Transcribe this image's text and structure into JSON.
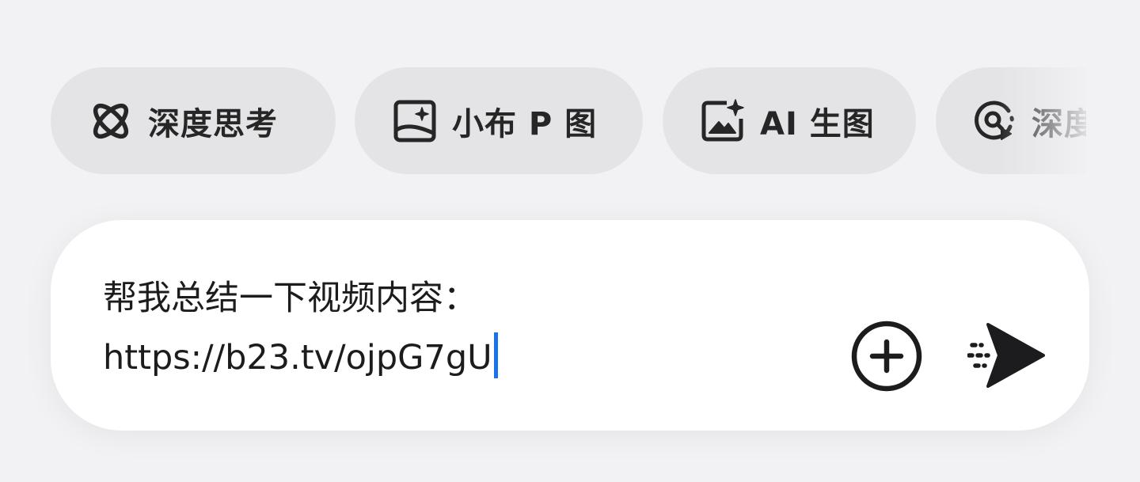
{
  "chips": [
    {
      "label": "深度思考",
      "icon": "atom-icon"
    },
    {
      "label": "小布 P 图",
      "icon": "image-edit-icon"
    },
    {
      "label": "AI 生图",
      "icon": "image-sparkle-icon"
    },
    {
      "label": "深度",
      "icon": "video-search-icon"
    }
  ],
  "input": {
    "line1": "帮我总结一下视频内容：",
    "line2": "https://b23.tv/ojpG7gU"
  },
  "buttons": {
    "add_icon": "plus-circle-icon",
    "send_icon": "send-icon"
  },
  "colors": {
    "background": "#f2f2f4",
    "chip": "#e4e4e6",
    "caret": "#1a73e8"
  }
}
